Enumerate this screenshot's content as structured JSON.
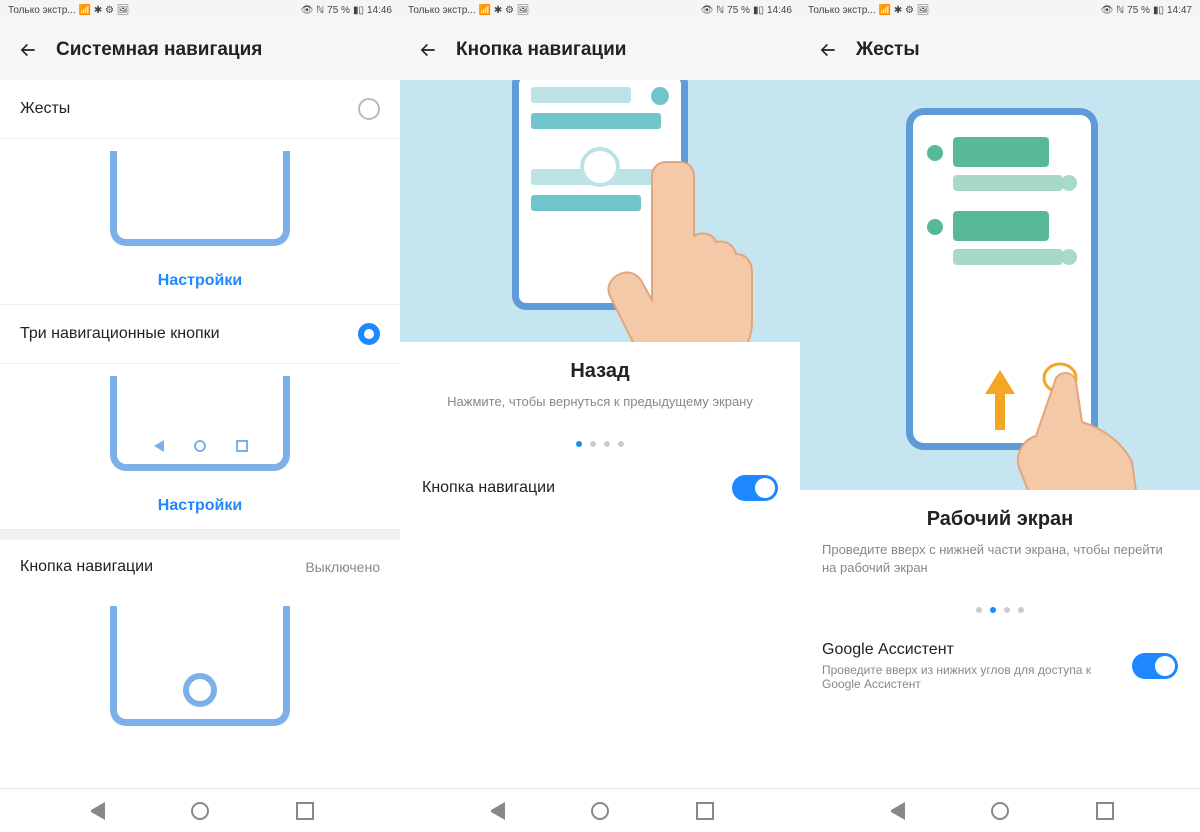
{
  "status": {
    "carrier": "Только экстр...",
    "battery": "75 %",
    "time1": "14:46",
    "time2": "14:46",
    "time3": "14:47"
  },
  "screen1": {
    "title": "Системная навигация",
    "opt_gestures": "Жесты",
    "opt_three": "Три навигационные кнопки",
    "settings": "Настройки",
    "opt_button": "Кнопка навигации",
    "opt_button_val": "Выключено"
  },
  "screen2": {
    "title": "Кнопка навигации",
    "desc_title": "Назад",
    "desc_text": "Нажмите, чтобы вернуться к предыдущему экрану",
    "toggle": "Кнопка навигации",
    "page_active": 1,
    "page_count": 4
  },
  "screen3": {
    "title": "Жесты",
    "desc_title": "Рабочий экран",
    "desc_text": "Проведите вверх с нижней части экрана, чтобы перейти на рабочий экран",
    "toggle_title": "Google Ассистент",
    "toggle_sub": "Проведите вверх из нижних углов для доступа к Google Ассистент",
    "page_active": 2,
    "page_count": 4
  }
}
